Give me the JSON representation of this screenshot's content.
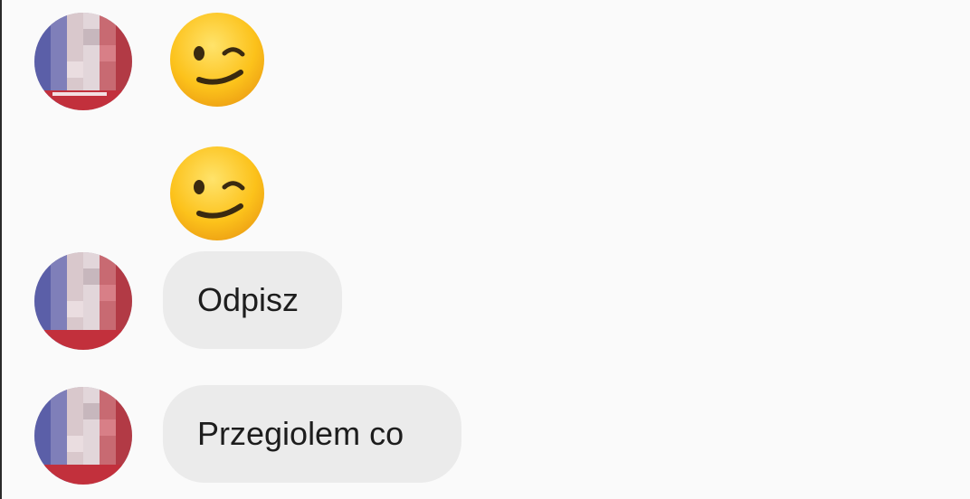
{
  "conversation": {
    "messages": [
      {
        "type": "emoji",
        "emoji": "winking-face",
        "has_avatar": true
      },
      {
        "type": "emoji",
        "emoji": "winking-face",
        "has_avatar": false
      },
      {
        "type": "text",
        "text": "Odpisz",
        "has_avatar": true
      },
      {
        "type": "text",
        "text": "Przegiolem co",
        "has_avatar": true
      }
    ]
  },
  "colors": {
    "background": "#fafafa",
    "bubble": "#ebebeb",
    "text": "#1d1d1d",
    "emoji_face": "#fcc21b"
  }
}
